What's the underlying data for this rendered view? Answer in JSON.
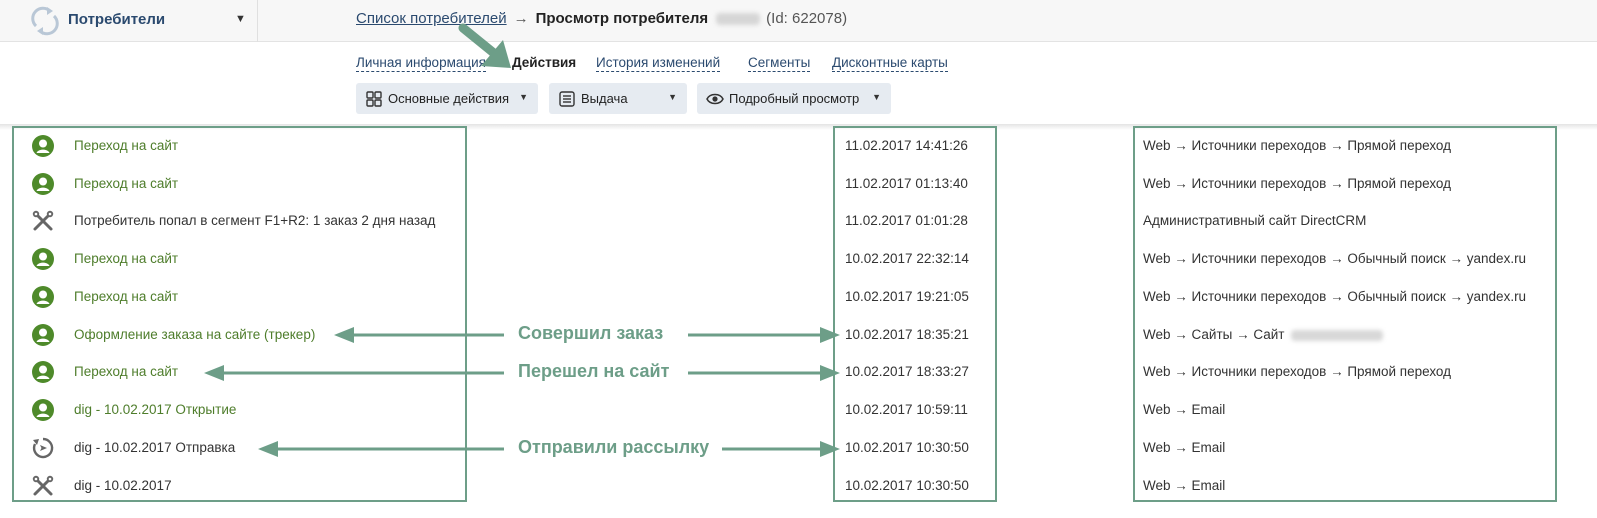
{
  "header": {
    "section": "Потребители",
    "breadcrumb_link": "Список потребителей",
    "breadcrumb_sep": "→",
    "breadcrumb_current": "Просмотр потребителя",
    "breadcrumb_id": "(Id: 622078)"
  },
  "tabs": [
    {
      "label": "Личная информация"
    },
    {
      "label": "Действия"
    },
    {
      "label": "История изменений"
    },
    {
      "label": "Сегменты"
    },
    {
      "label": "Дисконтные карты"
    }
  ],
  "toolbar": {
    "main_actions": "Основные действия",
    "output": "Выдача",
    "detailed_view": "Подробный просмотр"
  },
  "rows": [
    {
      "icon": "user-icon",
      "action": "Переход на сайт",
      "datetime": "11.02.2017 14:41:26",
      "source": "Web → Источники переходов → Прямой переход"
    },
    {
      "icon": "user-icon",
      "action": "Переход на сайт",
      "datetime": "11.02.2017 01:13:40",
      "source": "Web → Источники переходов → Прямой переход"
    },
    {
      "icon": "tools-icon",
      "action": "Потребитель попал в сегмент F1+R2: 1 заказ 2 дня назад",
      "datetime": "11.02.2017 01:01:28",
      "source": "Административный сайт DirectCRM"
    },
    {
      "icon": "user-icon",
      "action": "Переход на сайт",
      "datetime": "10.02.2017 22:32:14",
      "source": "Web → Источники переходов → Обычный поиск → yandex.ru"
    },
    {
      "icon": "user-icon",
      "action": "Переход на сайт",
      "datetime": "10.02.2017 19:21:05",
      "source": "Web → Источники переходов → Обычный поиск → yandex.ru"
    },
    {
      "icon": "user-icon",
      "action": "Оформление заказа на сайте (трекер)",
      "datetime": "10.02.2017 18:35:21",
      "source": "Web → Сайты → Сайт"
    },
    {
      "icon": "user-icon",
      "action": "Переход на сайт",
      "datetime": "10.02.2017 18:33:27",
      "source": "Web → Источники переходов → Прямой переход"
    },
    {
      "icon": "user-icon",
      "action": "dig - 10.02.2017 Открытие",
      "datetime": "10.02.2017 10:59:11",
      "source": "Web → Email"
    },
    {
      "icon": "send-icon",
      "action": "dig - 10.02.2017 Отправка",
      "datetime": "10.02.2017 10:30:50",
      "source": "Web → Email"
    },
    {
      "icon": "tools-icon",
      "action": "dig - 10.02.2017",
      "datetime": "10.02.2017 10:30:50",
      "source": "Web → Email"
    }
  ],
  "annotations": {
    "order": "Совершил заказ",
    "visit": "Перешел на сайт",
    "mailing": "Отправили рассылку"
  },
  "colors": {
    "user_icon": "#4e8a2a",
    "annotation": "#6d9e88",
    "link": "#2b4a6f"
  }
}
